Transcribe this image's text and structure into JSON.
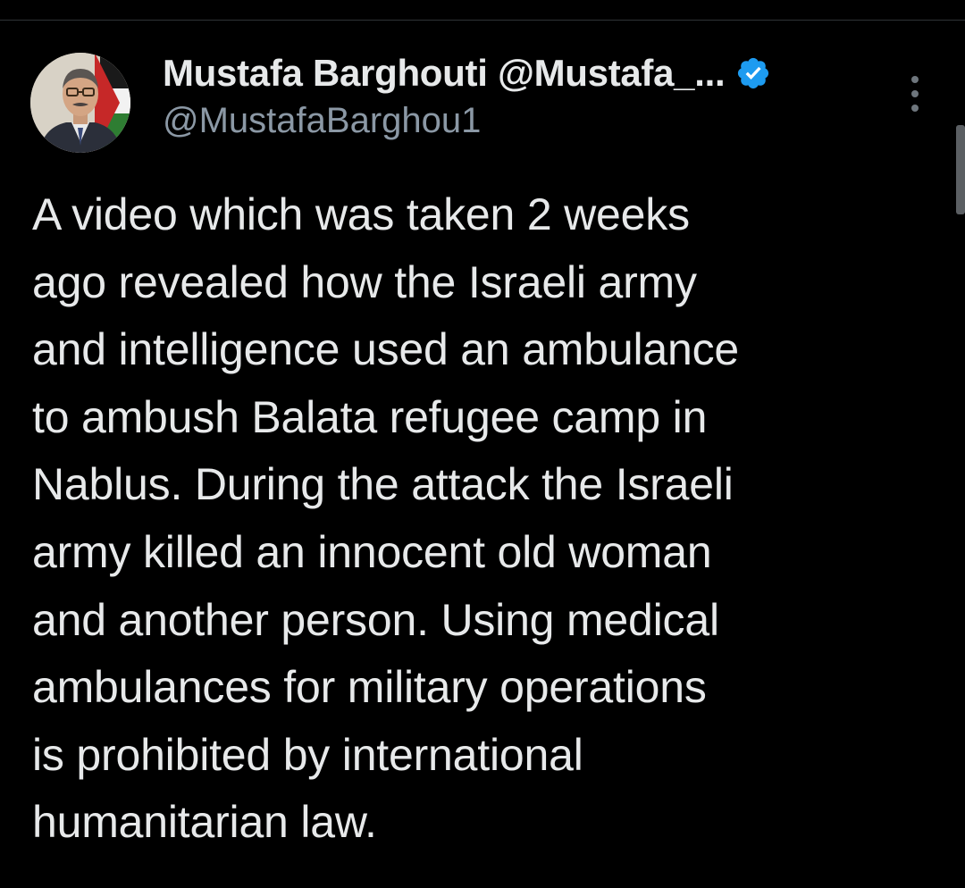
{
  "tweet": {
    "author": {
      "display_name": "Mustafa Barghouti @Mustafa_...",
      "handle": "@MustafaBarghou1",
      "verified": true,
      "verified_icon": "verified-badge-icon",
      "avatar": "profile-photo"
    },
    "text": "A video which was taken 2 weeks\nago revealed how the Israeli army\nand intelligence used an ambulance\nto ambush Balata refugee camp in\nNablus. During the attack the Israeli\narmy killed an innocent old woman\nand another person. Using medical\nambulances for military operations\nis prohibited by international\nhumanitarian law.",
    "more_icon": "more-options-icon"
  },
  "colors": {
    "background": "#000000",
    "text_primary": "#e7e9ea",
    "text_secondary": "#8b98a5",
    "verified_blue": "#1d9bf0"
  }
}
